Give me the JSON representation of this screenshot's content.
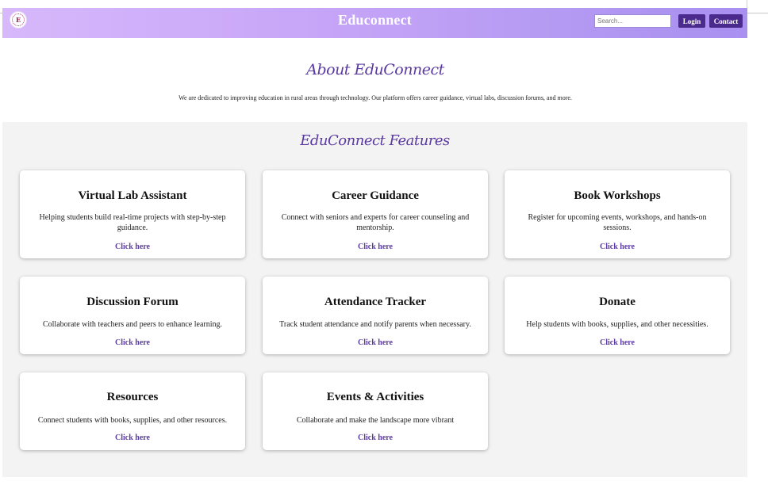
{
  "header": {
    "brand": "Educonnect",
    "logo_icon": "school-seal-icon",
    "search_placeholder": "Search...",
    "login_label": "Login",
    "contact_label": "Contact",
    "gradient_start": "#d7b8fb",
    "gradient_end": "#a98ff0",
    "button_color": "#4a2a8c"
  },
  "about": {
    "title": "About EduConnect",
    "text": "We are dedicated to improving education in rural areas through technology. Our platform offers career guidance, virtual labs, discussion forums, and more."
  },
  "features": {
    "title": "EduConnect Features",
    "link_color": "#5a3aa0",
    "cards": [
      {
        "title": "Virtual Lab Assistant",
        "description": "Helping students build real-time projects with step-by-step guidance.",
        "link": "Click here"
      },
      {
        "title": "Career Guidance",
        "description": "Connect with seniors and experts for career counseling and mentorship.",
        "link": "Click here"
      },
      {
        "title": "Book Workshops",
        "description": "Register for upcoming events, workshops, and hands-on sessions.",
        "link": "Click here"
      },
      {
        "title": "Discussion Forum",
        "description": "Collaborate with teachers and peers to enhance learning.",
        "link": "Click here"
      },
      {
        "title": "Attendance Tracker",
        "description": "Track student attendance and notify parents when necessary.",
        "link": "Click here"
      },
      {
        "title": "Donate",
        "description": "Help students with books, supplies, and other necessities.",
        "link": "Click here"
      },
      {
        "title": "Resources",
        "description": "Connect students with books, supplies, and other resources.",
        "link": "Click here"
      },
      {
        "title": "Events & Activities",
        "description": "Collaborate and make the landscape more vibrant",
        "link": "Click here"
      }
    ]
  }
}
